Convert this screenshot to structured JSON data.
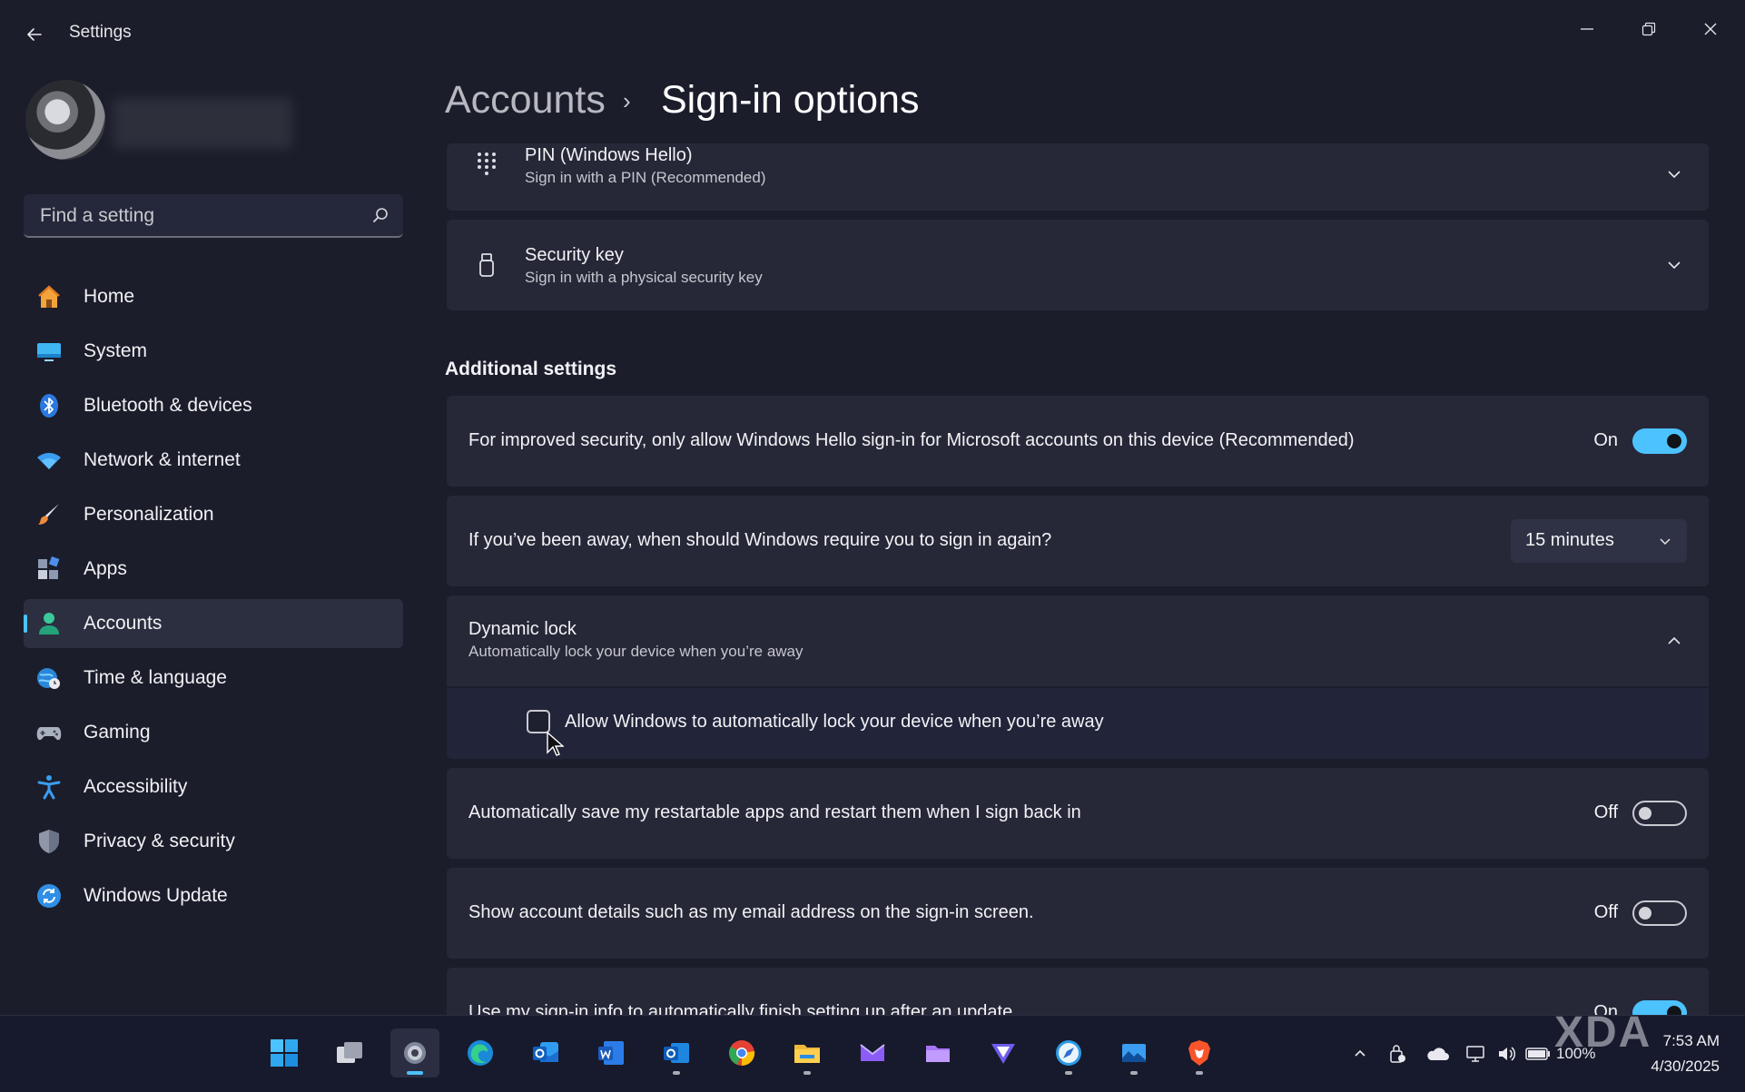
{
  "window": {
    "title": "Settings",
    "back_icon": "back-arrow-icon",
    "minimize_icon": "minimize-icon",
    "maximize_icon": "restore-icon",
    "close_icon": "close-icon"
  },
  "sidebar": {
    "search_placeholder": "Find a setting",
    "items": [
      {
        "label": "Home",
        "icon": "home-icon"
      },
      {
        "label": "System",
        "icon": "system-icon"
      },
      {
        "label": "Bluetooth & devices",
        "icon": "bluetooth-icon"
      },
      {
        "label": "Network & internet",
        "icon": "wifi-icon"
      },
      {
        "label": "Personalization",
        "icon": "brush-icon"
      },
      {
        "label": "Apps",
        "icon": "apps-icon"
      },
      {
        "label": "Accounts",
        "icon": "accounts-icon",
        "active": true
      },
      {
        "label": "Time & language",
        "icon": "globe-clock-icon"
      },
      {
        "label": "Gaming",
        "icon": "gamepad-icon"
      },
      {
        "label": "Accessibility",
        "icon": "accessibility-icon"
      },
      {
        "label": "Privacy & security",
        "icon": "shield-icon"
      },
      {
        "label": "Windows Update",
        "icon": "update-icon"
      }
    ]
  },
  "breadcrumb": {
    "parent": "Accounts",
    "separator": "›",
    "current": "Sign-in options"
  },
  "sign_in_methods": [
    {
      "title": "PIN (Windows Hello)",
      "subtitle": "Sign in with a PIN (Recommended)",
      "icon": "keypad-icon"
    },
    {
      "title": "Security key",
      "subtitle": "Sign in with a physical security key",
      "icon": "usb-key-icon"
    }
  ],
  "additional": {
    "heading": "Additional settings",
    "hello_only": {
      "text": "For improved security, only allow Windows Hello sign-in for Microsoft accounts on this device (Recommended)",
      "state_label": "On",
      "on": true
    },
    "require_signin": {
      "text": "If you’ve been away, when should Windows require you to sign in again?",
      "selected": "15 minutes"
    },
    "dynamic_lock": {
      "title": "Dynamic lock",
      "subtitle": "Automatically lock your device when you’re away",
      "expanded": true,
      "checkbox_label": "Allow Windows to automatically lock your device when you’re away",
      "checked": false
    },
    "restart_apps": {
      "text": "Automatically save my restartable apps and restart them when I sign back in",
      "state_label": "Off",
      "on": false
    },
    "account_details": {
      "text": "Show account details such as my email address on the sign-in screen.",
      "state_label": "Off",
      "on": false
    },
    "use_signin_info": {
      "text": "Use my sign-in info to automatically finish setting up after an update",
      "state_label": "On",
      "on": true
    }
  },
  "taskbar": {
    "apps": [
      "start-icon",
      "task-view-icon",
      "settings-icon",
      "edge-icon",
      "outlook-new-icon",
      "word-icon",
      "outlook-icon",
      "chrome-icon",
      "file-explorer-icon",
      "mail-icon",
      "folder-icon",
      "vpn-icon",
      "safari-icon",
      "photos-icon",
      "brave-icon"
    ],
    "battery": "100%",
    "time": "7:53 AM",
    "date": "4/30/2025"
  },
  "watermark": "XDA",
  "colors": {
    "accent": "#4cc2ff",
    "background": "#1b1d2b",
    "card": "#262838"
  }
}
